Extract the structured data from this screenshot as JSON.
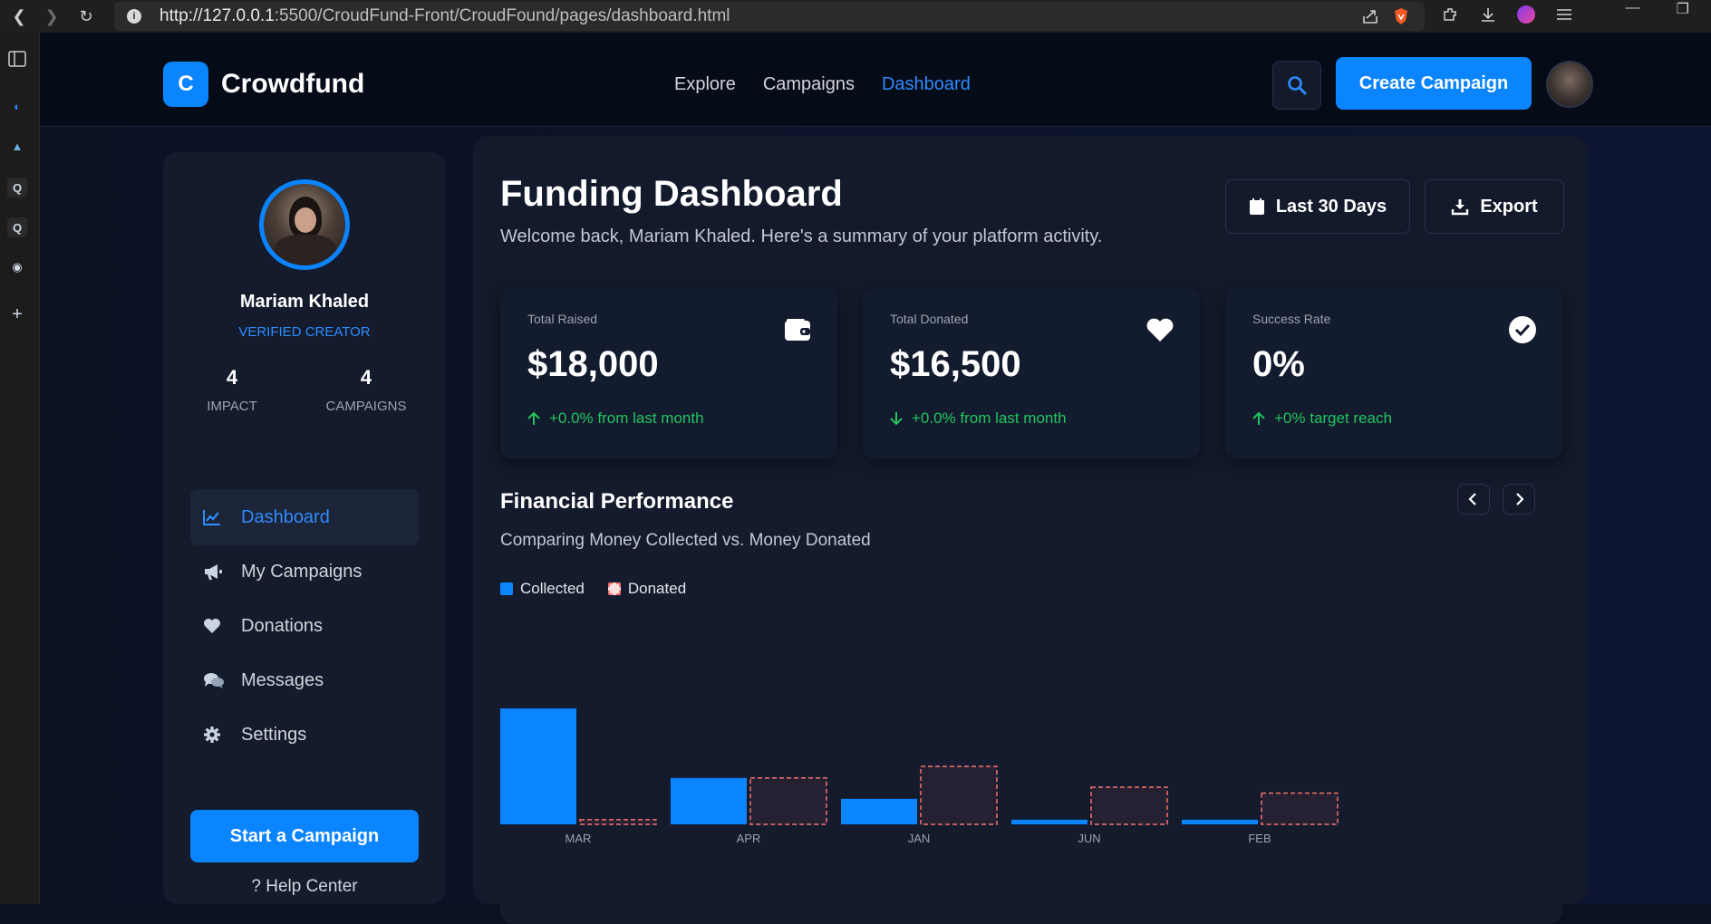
{
  "browser": {
    "url_host": "http://127.0.0.1",
    "url_path": ":5500/CroudFund-Front/CroudFound/pages/dashboard.html"
  },
  "nav": {
    "logo_letter": "C",
    "logo_text": "Crowdfund",
    "links": [
      "Explore",
      "Campaigns",
      "Dashboard"
    ],
    "active_link": "Dashboard",
    "create_label": "Create Campaign"
  },
  "profile": {
    "name": "Mariam Khaled",
    "role": "VERIFIED CREATOR",
    "stats": [
      {
        "value": "4",
        "label": "IMPACT"
      },
      {
        "value": "4",
        "label": "CAMPAIGNS"
      }
    ]
  },
  "sidebar": {
    "items": [
      {
        "label": "Dashboard",
        "icon": "chart-line-icon"
      },
      {
        "label": "My Campaigns",
        "icon": "megaphone-icon"
      },
      {
        "label": "Donations",
        "icon": "heart-icon"
      },
      {
        "label": "Messages",
        "icon": "comments-icon"
      },
      {
        "label": "Settings",
        "icon": "gear-icon"
      }
    ],
    "start_label": "Start a Campaign",
    "help_label": "? Help Center"
  },
  "dashboard": {
    "title": "Funding Dashboard",
    "subtitle": "Welcome back, Mariam Khaled. Here's a summary of your platform activity.",
    "range_label": "Last 30 Days",
    "export_label": "Export",
    "cards": [
      {
        "label": "Total Raised",
        "value": "$18,000",
        "trend": "+0.0% from last month",
        "direction": "up",
        "icon": "wallet-icon"
      },
      {
        "label": "Total Donated",
        "value": "$16,500",
        "trend": "+0.0% from last month",
        "direction": "down",
        "icon": "heart-icon"
      },
      {
        "label": "Success Rate",
        "value": "0%",
        "trend": "+0% target reach",
        "direction": "up",
        "icon": "check-circle-icon"
      }
    ]
  },
  "performance": {
    "title": "Financial Performance",
    "subtitle": "Comparing Money Collected vs. Money Donated",
    "legend": [
      "Collected",
      "Donated"
    ]
  },
  "colors": {
    "accent": "#0b84ff",
    "donated": "#f87171",
    "positive": "#22c55e"
  },
  "chart_data": {
    "type": "bar",
    "categories": [
      "MAR",
      "APR",
      "JAN",
      "JUN",
      "FEB"
    ],
    "series": [
      {
        "name": "Collected",
        "values": [
          10000,
          4000,
          2200,
          400,
          400
        ]
      },
      {
        "name": "Donated",
        "values": [
          400,
          4000,
          5000,
          3200,
          2700
        ]
      }
    ],
    "ylim": [
      0,
      10000
    ],
    "grid": false,
    "legend": "top-left"
  }
}
